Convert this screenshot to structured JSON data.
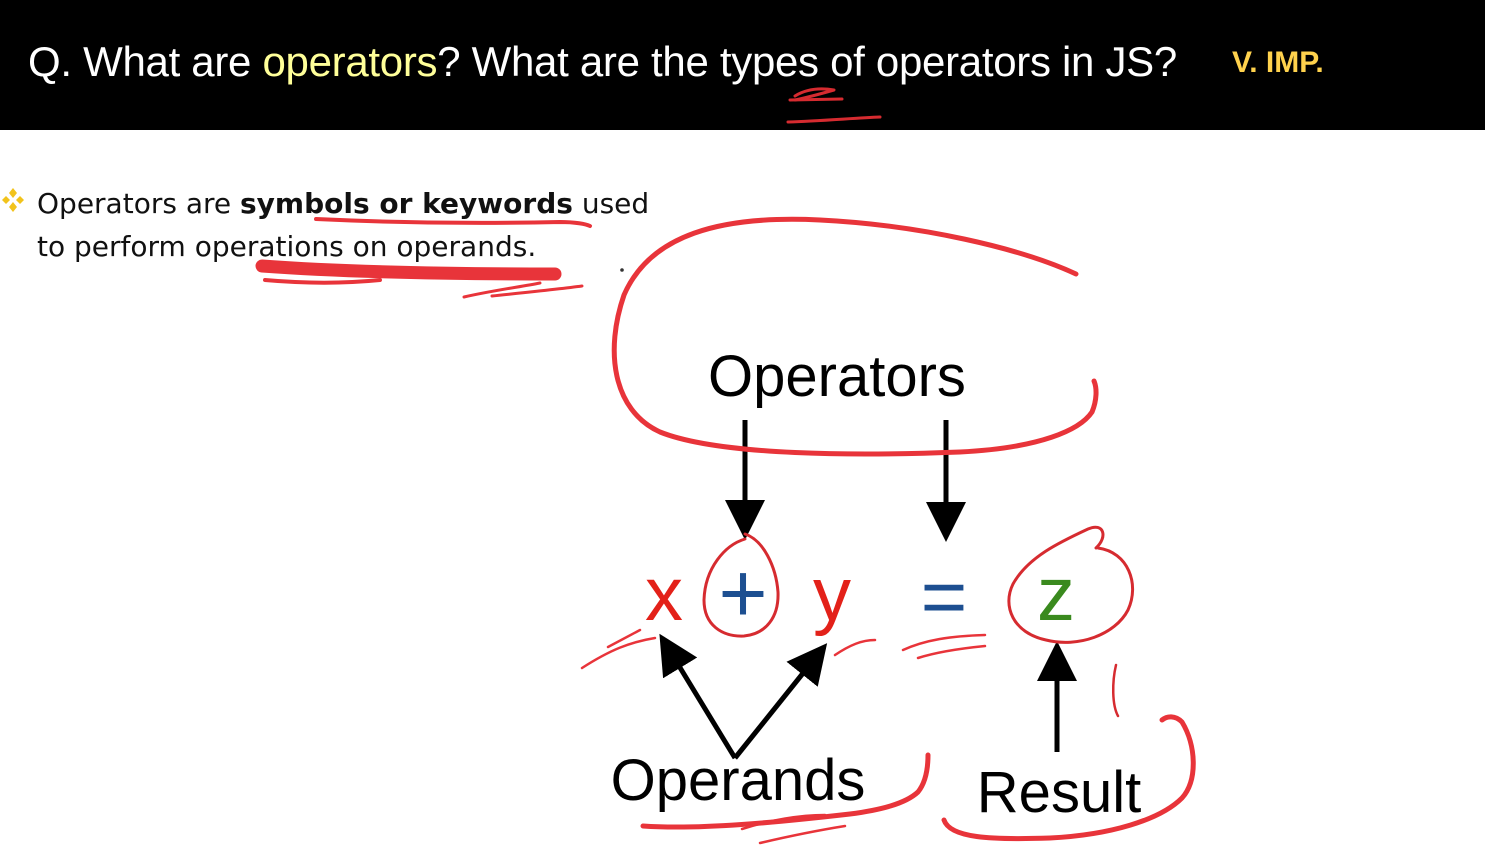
{
  "header": {
    "q_prefix": "Q. What are ",
    "q_highlight": "operators",
    "q_suffix": "? What are the types of operators in JS?",
    "importance": "V. IMP."
  },
  "bullet": {
    "icon": "diamond-bullet-icon",
    "text_start": "Operators are ",
    "text_bold": "symbols or keywords",
    "text_end": " used to perform operations on operands."
  },
  "diagram": {
    "operators_label": "Operators",
    "operand_x": "x",
    "operator_symbol": "+",
    "operand_y": "y",
    "equals_symbol": "=",
    "result_var": "z",
    "operands_label": "Operands",
    "result_label": "Result"
  },
  "colors": {
    "header_bg": "#000000",
    "highlight": "#ffff99",
    "importance": "#ffd24d",
    "operand": "#e32119",
    "operator": "#1d4f91",
    "result": "#3a8a1e",
    "annotation": "#e8343a"
  }
}
